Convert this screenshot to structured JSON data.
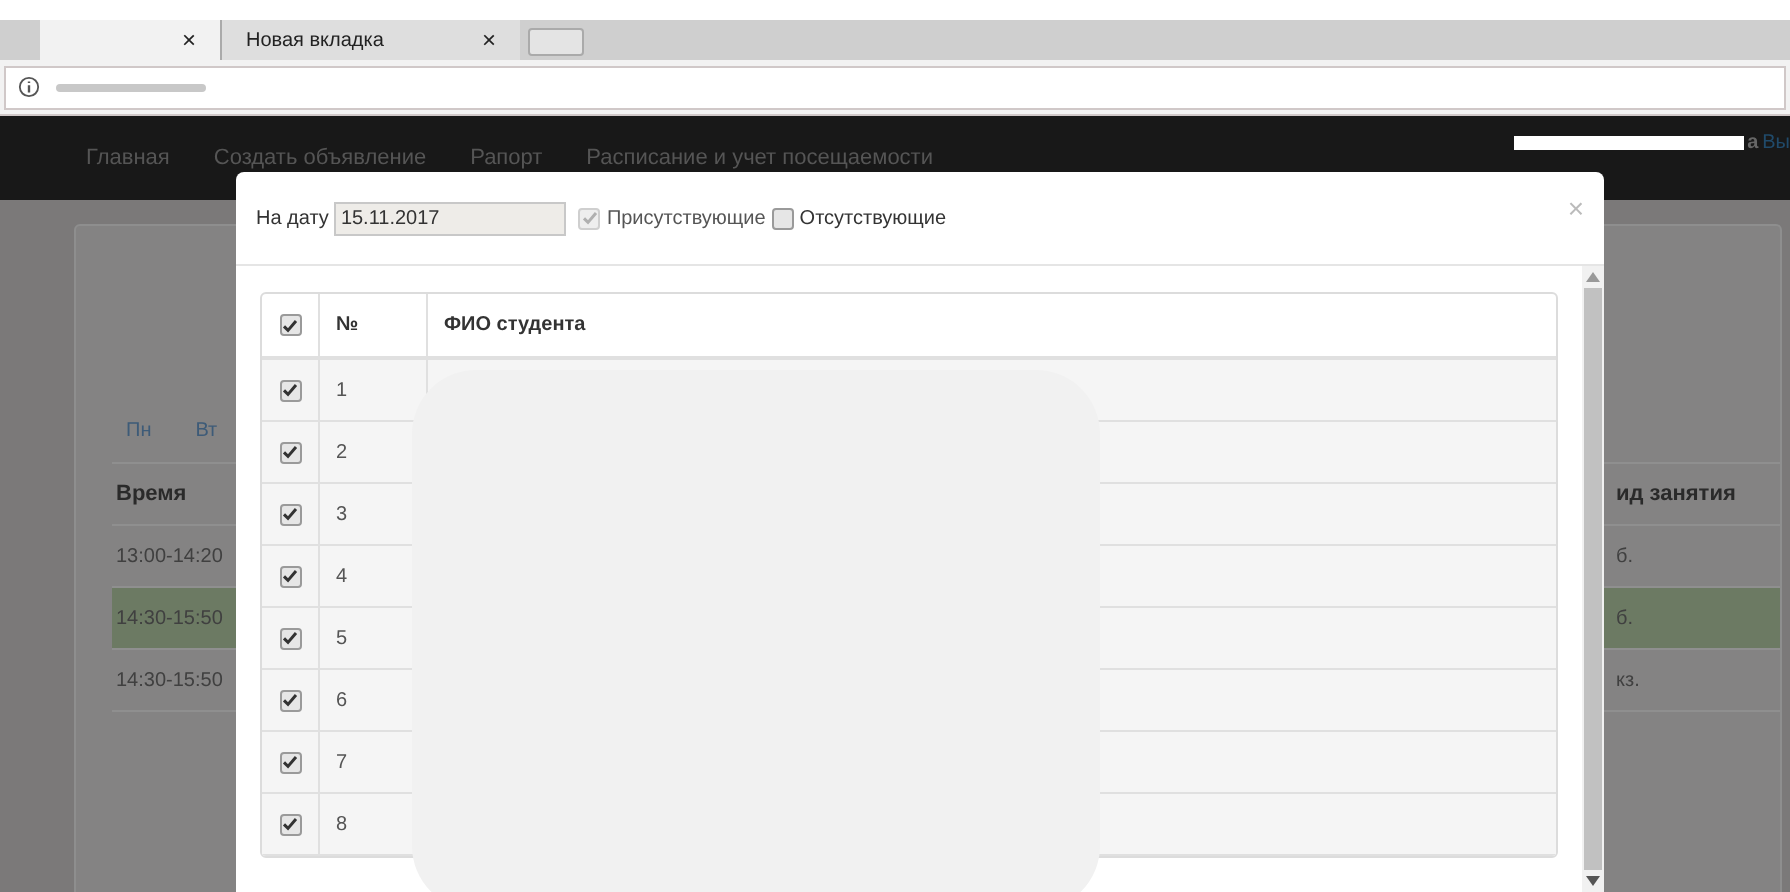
{
  "browser": {
    "tabs": [
      {
        "close": "×",
        "selected": true
      },
      {
        "title": "Новая вкладка",
        "close": "×",
        "selected": false
      }
    ]
  },
  "navbar": {
    "items": [
      "Главная",
      "Создать объявление",
      "Рапорт",
      "Расписание и учет посещаемости"
    ],
    "user_suffix": "а",
    "logout": "Вы"
  },
  "day_tabs": [
    "Пн",
    "Вт"
  ],
  "schedule": {
    "columns": [
      "Время",
      "ид занятия"
    ],
    "rows": [
      {
        "time": "13:00-14:20",
        "type": "б.",
        "selected": false
      },
      {
        "time": "14:30-15:50",
        "type": "б.",
        "selected": true
      },
      {
        "time": "14:30-15:50",
        "type": "кз.",
        "selected": false
      }
    ]
  },
  "modal": {
    "date_label": "На дату",
    "date_value": "15.11.2017",
    "close": "×",
    "filters": [
      {
        "label": "Присутствующие",
        "checked": true,
        "disabled": true
      },
      {
        "label": "Отсутствующие",
        "checked": false,
        "disabled": false
      }
    ],
    "table": {
      "select_all": true,
      "columns": [
        "№",
        "ФИО студента"
      ],
      "rows": [
        {
          "number": "1",
          "checked": true
        },
        {
          "number": "2",
          "checked": true
        },
        {
          "number": "3",
          "checked": true
        },
        {
          "number": "4",
          "checked": true
        },
        {
          "number": "5",
          "checked": true
        },
        {
          "number": "6",
          "checked": true
        },
        {
          "number": "7",
          "checked": true
        },
        {
          "number": "8",
          "checked": true
        }
      ]
    }
  }
}
